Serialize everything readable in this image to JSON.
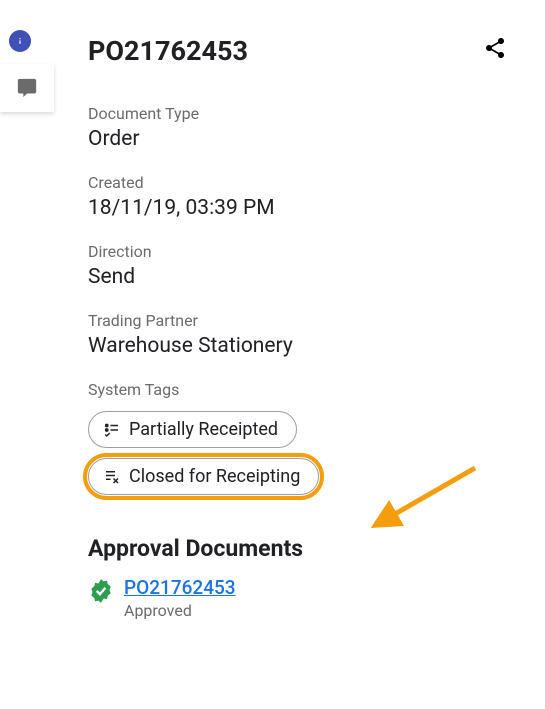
{
  "document": {
    "number": "PO21762453"
  },
  "fields": {
    "documentType": {
      "label": "Document Type",
      "value": "Order"
    },
    "created": {
      "label": "Created",
      "value": "18/11/19, 03:39 PM"
    },
    "direction": {
      "label": "Direction",
      "value": "Send"
    },
    "tradingPartner": {
      "label": "Trading Partner",
      "value": "Warehouse Stationery"
    }
  },
  "systemTags": {
    "label": "System Tags",
    "tags": [
      {
        "name": "Partially Receipted",
        "icon": "partially-receipted"
      },
      {
        "name": "Closed for Receipting",
        "icon": "closed-receipting",
        "highlighted": true
      }
    ]
  },
  "approvalDocuments": {
    "heading": "Approval Documents",
    "items": [
      {
        "link": "PO21762453",
        "status": "Approved"
      }
    ]
  }
}
